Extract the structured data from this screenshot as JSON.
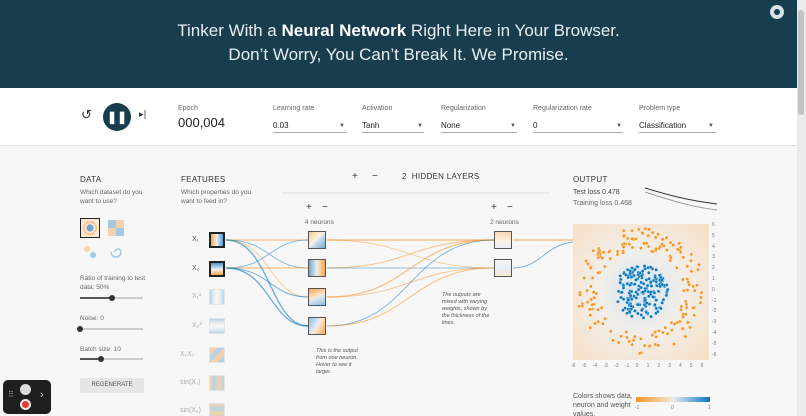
{
  "header": {
    "line1_pre": "Tinker With a ",
    "line1_bold": "Neural Network",
    "line1_post": " Right Here in Your Browser.",
    "line2": "Don’t Worry, You Can’t Break It. We Promise."
  },
  "controls": {
    "epoch_label": "Epoch",
    "epoch_value": "000,004",
    "learning_rate_label": "Learning rate",
    "learning_rate_value": "0.03",
    "activation_label": "Activation",
    "activation_value": "Tanh",
    "regularization_label": "Regularization",
    "regularization_value": "None",
    "reg_rate_label": "Regularization rate",
    "reg_rate_value": "0",
    "problem_type_label": "Problem type",
    "problem_type_value": "Classification",
    "play_glyph": "❚❚",
    "reset_glyph": "↺",
    "step_glyph": "▸|"
  },
  "data_panel": {
    "title": "DATA",
    "question": "Which dataset do you want to use?",
    "ratio_label": "Ratio of training to test data:",
    "ratio_value": "50%",
    "ratio_fraction": 0.5,
    "noise_label": "Noise:",
    "noise_value": "0",
    "noise_fraction": 0,
    "batch_label": "Batch size:",
    "batch_value": "10",
    "batch_fraction": 0.33,
    "regenerate": "REGENERATE"
  },
  "features": {
    "title": "FEATURES",
    "question": "Which properties do you want to feed in?",
    "items": [
      {
        "label": "X₁",
        "active": true
      },
      {
        "label": "X₂",
        "active": true
      },
      {
        "label": "X₁²",
        "active": false
      },
      {
        "label": "X₂²",
        "active": false
      },
      {
        "label": "X₁X₂",
        "active": false
      },
      {
        "label": "sin(X₁)",
        "active": false
      },
      {
        "label": "sin(X₂)",
        "active": false
      }
    ]
  },
  "network": {
    "layer_count": "2",
    "hidden_layers_label": "HIDDEN LAYERS",
    "layer1_neurons": "4 neurons",
    "layer2_neurons": "2 neurons",
    "plus": "+",
    "minus": "−",
    "annot_neuron": "This is the output from one neuron. Hover to see it larger.",
    "annot_weights": "The outputs are mixed with varying weights, shown by the thickness of the lines."
  },
  "output": {
    "title": "OUTPUT",
    "test_loss": "Test loss 0.478",
    "training_loss": "Training loss 0.468",
    "colors_text": "Colors shows data, neuron and weight values.",
    "legend_ticks": [
      "-1",
      "0",
      "1"
    ],
    "x_ticks": [
      "-6",
      "-5",
      "-4",
      "-3",
      "-2",
      "-1",
      "0",
      "1",
      "2",
      "3",
      "4",
      "5",
      "6"
    ],
    "y_ticks": [
      "6",
      "5",
      "4",
      "3",
      "2",
      "1",
      "0",
      "-1",
      "-2",
      "-3",
      "-4",
      "-5",
      "-6"
    ]
  },
  "colors": {
    "orange": "#f59322",
    "blue": "#0877bd",
    "header": "#183d4e"
  }
}
